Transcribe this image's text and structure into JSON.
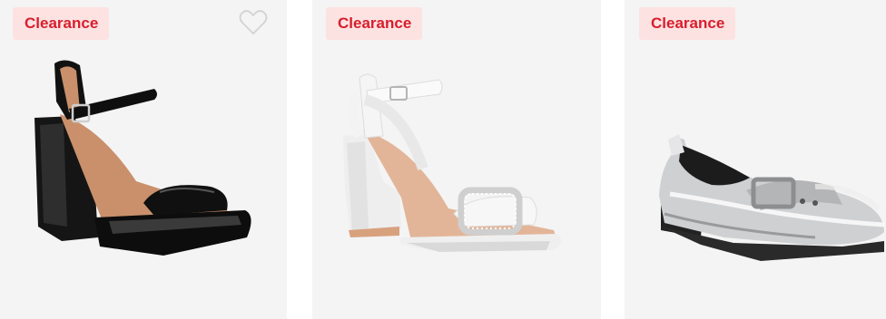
{
  "products": [
    {
      "badge": "Clearance",
      "image_icon": "black-patent-platform-heel-sandal-image",
      "favorite_icon": "heart-outline-icon",
      "colors": {
        "shoe": "#111111",
        "lining": "#c9906b"
      }
    },
    {
      "badge": "Clearance",
      "image_icon": "white-block-heel-buckle-sandal-image",
      "colors": {
        "shoe": "#f6f6f6",
        "lining": "#e3b598",
        "heel": "#d8a17e"
      }
    },
    {
      "badge": "Clearance",
      "image_icon": "silver-metallic-buckle-loafer-image",
      "colors": {
        "shoe": "#c9c9cb",
        "sole": "#2a2a2a"
      }
    }
  ],
  "theme": {
    "card_background": "#f4f4f4",
    "badge_background": "#fde2e2",
    "badge_text": "#d81e2c"
  }
}
